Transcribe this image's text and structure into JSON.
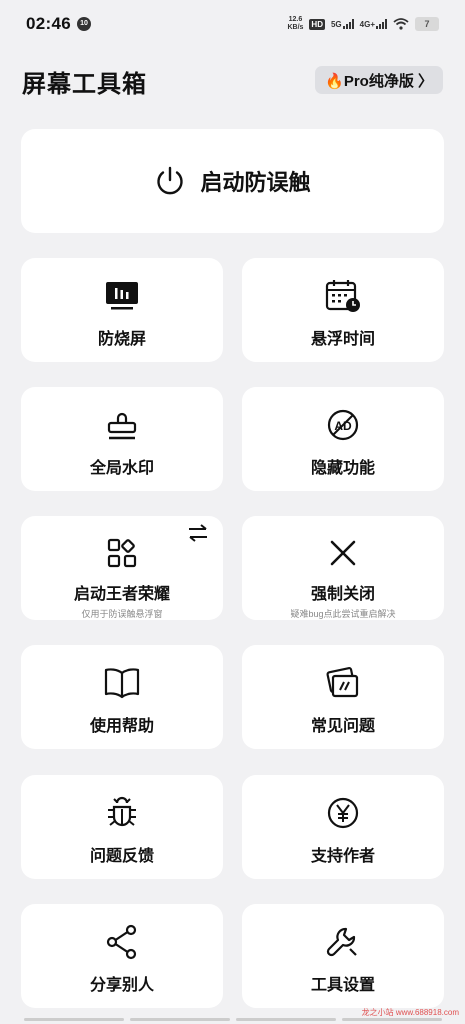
{
  "status": {
    "time": "02:46",
    "badge": "10",
    "netspeed_top": "12.6",
    "netspeed_bottom": "KB/s",
    "hd": "HD",
    "sig1": "5G",
    "sig2": "4G+",
    "battery": "7"
  },
  "header": {
    "title": "屏幕工具箱",
    "pro_label": "🔥Pro纯净版 〉"
  },
  "main_action": {
    "label": "启动防误触",
    "icon": "power-icon"
  },
  "tiles": [
    {
      "label": "防烧屏",
      "icon": "screen-icon"
    },
    {
      "label": "悬浮时间",
      "icon": "calendar-clock-icon"
    },
    {
      "label": "全局水印",
      "icon": "stamp-icon"
    },
    {
      "label": "隐藏功能",
      "icon": "ad-block-icon"
    },
    {
      "label": "启动王者荣耀",
      "sub": "仅用于防误触悬浮窗",
      "icon": "apps-grid-icon",
      "extra_icon": "swap-icon"
    },
    {
      "label": "强制关闭",
      "sub": "疑难bug点此尝试重启解决",
      "icon": "close-icon"
    },
    {
      "label": "使用帮助",
      "icon": "book-icon"
    },
    {
      "label": "常见问题",
      "icon": "cards-icon"
    },
    {
      "label": "问题反馈",
      "icon": "bug-icon"
    },
    {
      "label": "支持作者",
      "icon": "yen-icon"
    },
    {
      "label": "分享别人",
      "icon": "share-icon"
    },
    {
      "label": "工具设置",
      "icon": "wrench-icon"
    }
  ],
  "watermark": "龙之小站 www.688918.com"
}
